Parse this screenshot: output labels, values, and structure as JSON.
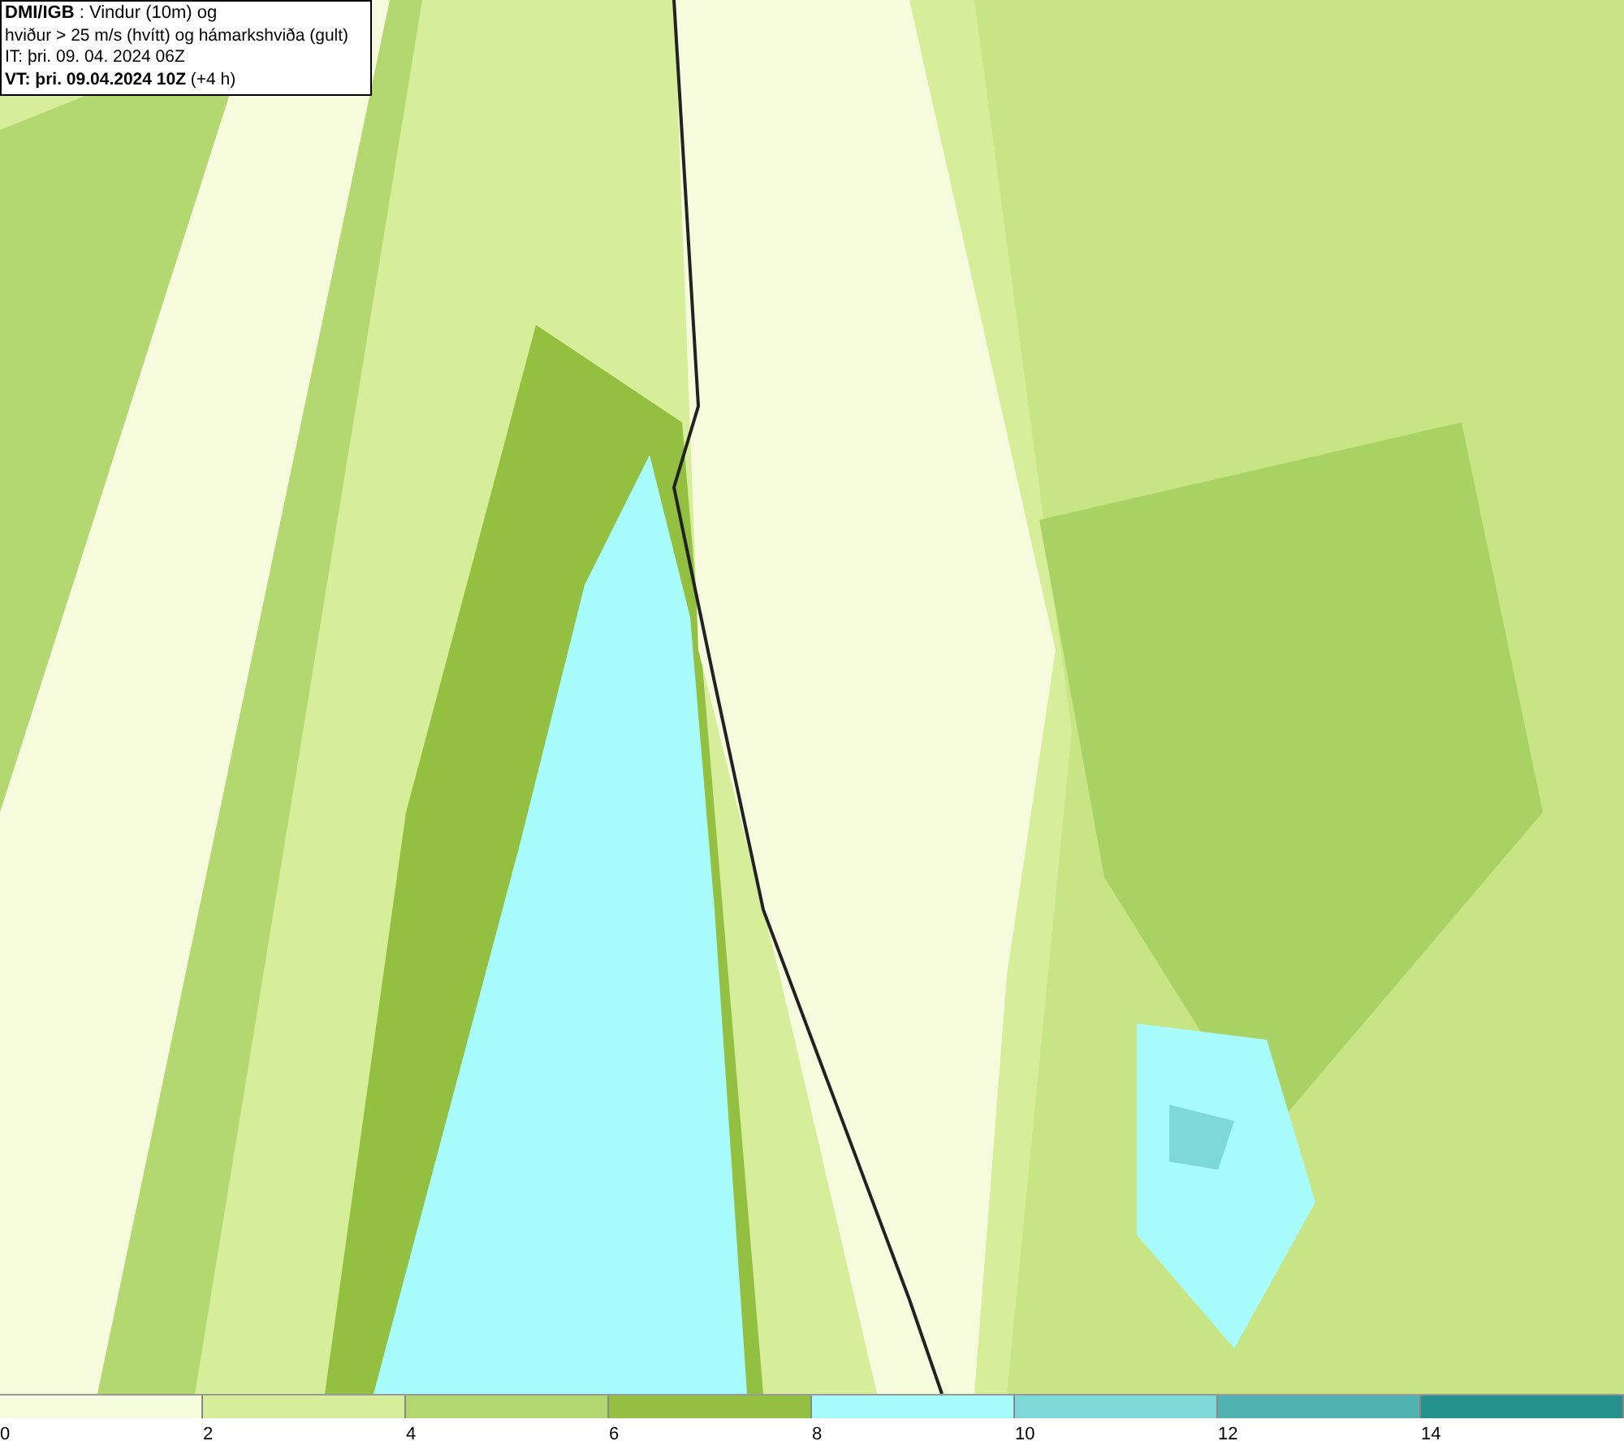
{
  "map": {
    "title_lines": [
      "**DMI/IGB** : Vindur (10m) og",
      "hviður > 25 m/s (hvítt) og hámarkshviða (gult)",
      "IT: þri. 09. 04. 2024 06Z",
      "**VT: þri. 09.04.2024 10Z** (+4 h)"
    ]
  },
  "legend": {
    "bins": [
      {
        "color": "#f5fbdc",
        "label": "0"
      },
      {
        "color": "#d6ee9a",
        "label": "2"
      },
      {
        "color": "#b3d870",
        "label": "4"
      },
      {
        "color": "#93c041",
        "label": "6"
      },
      {
        "color": "#a8fbfb",
        "label": "8"
      },
      {
        "color": "#7ed8d8",
        "label": "10"
      },
      {
        "color": "#52b2b2",
        "label": "12"
      },
      {
        "color": "#27918d",
        "label": "14"
      }
    ]
  }
}
